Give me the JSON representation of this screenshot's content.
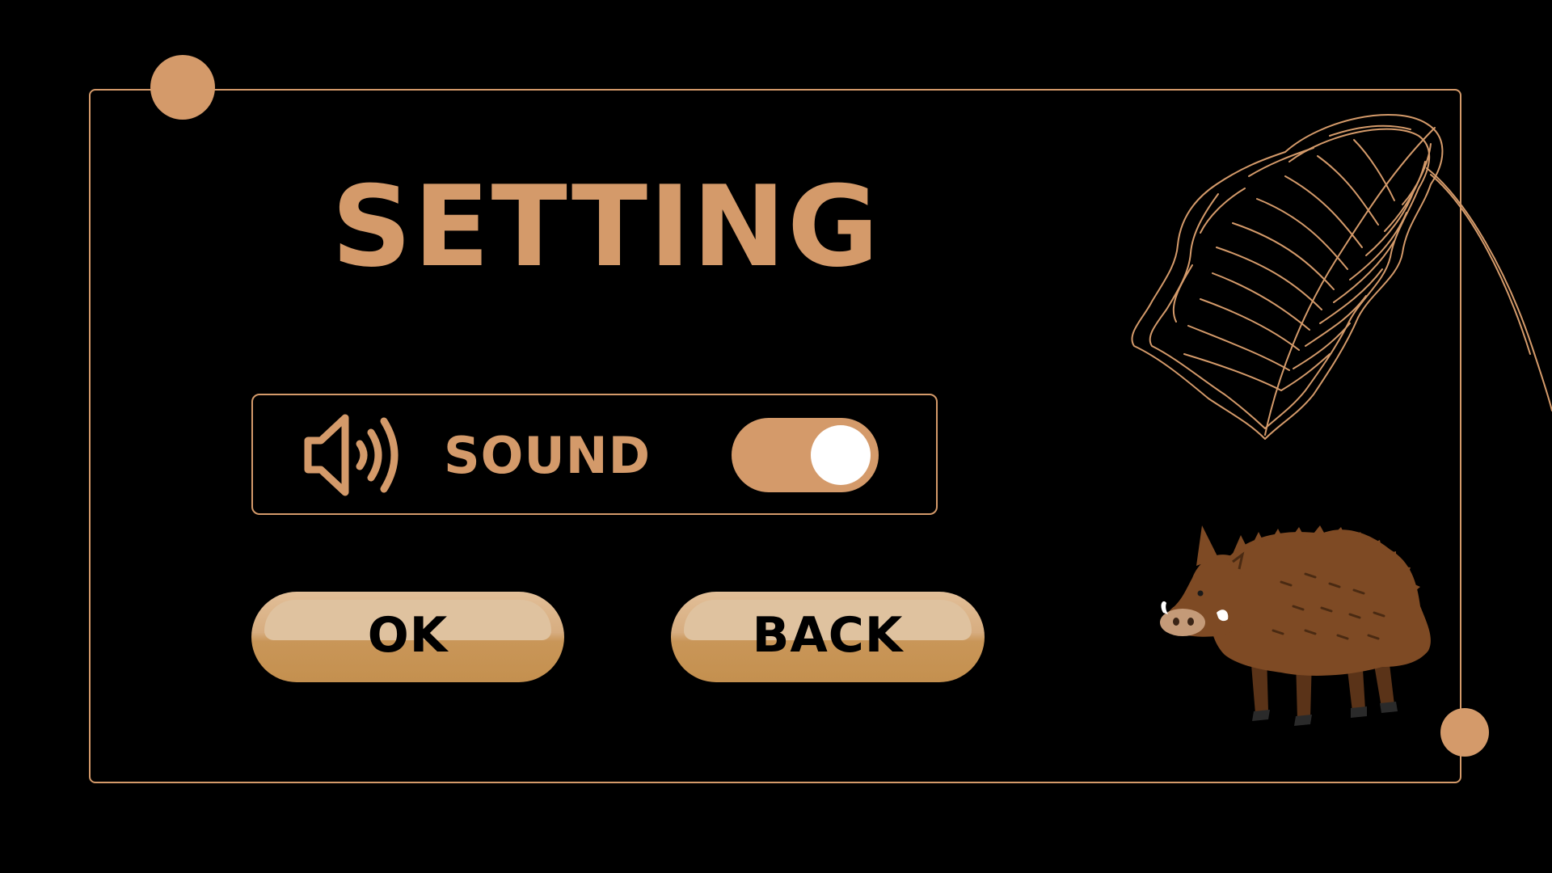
{
  "screen": {
    "title": "SETTING"
  },
  "sound": {
    "label": "SOUND",
    "enabled": true
  },
  "buttons": {
    "ok": "OK",
    "back": "BACK"
  },
  "icons": {
    "sound": "speaker-icon",
    "decor_leaf": "leaf-illustration",
    "decor_animal": "wild-boar-illustration"
  },
  "colors": {
    "background": "#000000",
    "accent": "#d49a6a",
    "toggle_knob": "#ffffff",
    "button_text": "#000000"
  }
}
